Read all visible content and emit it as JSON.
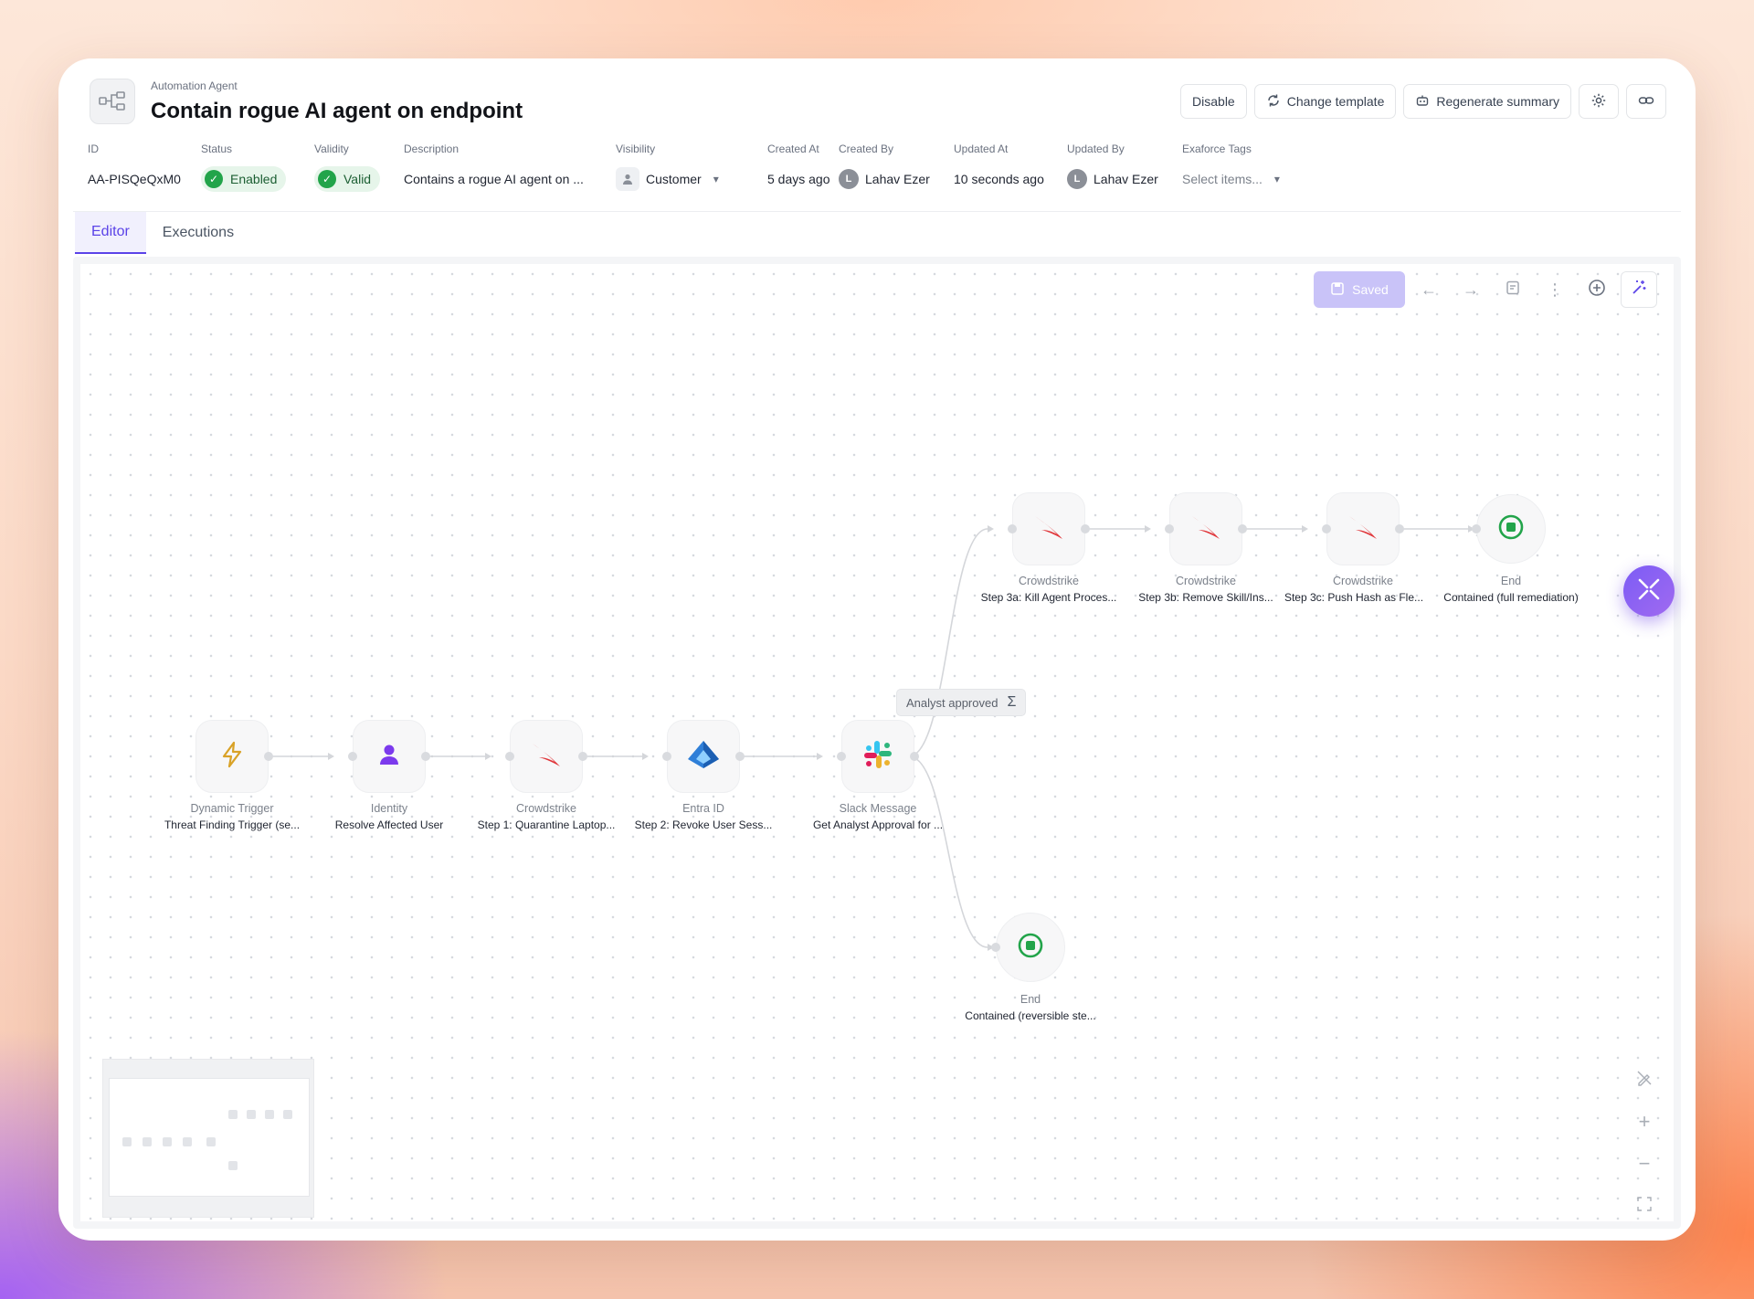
{
  "header": {
    "kicker": "Automation Agent",
    "title": "Contain rogue AI agent on endpoint",
    "actions": {
      "disable": "Disable",
      "change_template": "Change template",
      "regenerate_summary": "Regenerate summary"
    }
  },
  "meta": {
    "id": {
      "label": "ID",
      "value": "AA-PISQeQxM0"
    },
    "status": {
      "label": "Status",
      "value": "Enabled"
    },
    "validity": {
      "label": "Validity",
      "value": "Valid"
    },
    "description": {
      "label": "Description",
      "value": "Contains a rogue AI agent on ..."
    },
    "visibility": {
      "label": "Visibility",
      "value": "Customer"
    },
    "created_at": {
      "label": "Created At",
      "value": "5 days ago"
    },
    "created_by": {
      "label": "Created By",
      "value": "Lahav Ezer",
      "initial": "L"
    },
    "updated_at": {
      "label": "Updated At",
      "value": "10 seconds ago"
    },
    "updated_by": {
      "label": "Updated By",
      "value": "Lahav Ezer",
      "initial": "L"
    },
    "tags": {
      "label": "Exaforce Tags",
      "placeholder": "Select items..."
    }
  },
  "tabs": [
    {
      "label": "Editor",
      "active": true
    },
    {
      "label": "Executions",
      "active": false
    }
  ],
  "toolbar": {
    "saved_label": "Saved"
  },
  "workflow": {
    "edge_label": "Analyst approved",
    "nodes": [
      {
        "type": "Dynamic Trigger",
        "name": "Threat Finding Trigger (se...",
        "icon": "lightning-icon"
      },
      {
        "type": "Identity",
        "name": "Resolve Affected User",
        "icon": "user-icon"
      },
      {
        "type": "Crowdstrike",
        "name": "Step 1: Quarantine Laptop...",
        "icon": "crowdstrike-icon"
      },
      {
        "type": "Entra ID",
        "name": "Step 2: Revoke User Sess...",
        "icon": "entra-icon"
      },
      {
        "type": "Slack Message",
        "name": "Get Analyst Approval for ...",
        "icon": "slack-icon"
      },
      {
        "type": "Crowdstrike",
        "name": "Step 3a: Kill Agent Proces...",
        "icon": "crowdstrike-icon"
      },
      {
        "type": "Crowdstrike",
        "name": "Step 3b: Remove Skill/Ins...",
        "icon": "crowdstrike-icon"
      },
      {
        "type": "Crowdstrike",
        "name": "Step 3c: Push Hash as Fle...",
        "icon": "crowdstrike-icon"
      },
      {
        "type": "End",
        "name": "Contained (full remediation)",
        "icon": "stop-icon"
      },
      {
        "type": "End",
        "name": "Contained (reversible ste...",
        "icon": "stop-icon"
      }
    ]
  },
  "colors": {
    "accent": "#5b43e8",
    "success": "#22a44a",
    "crowdstrike": "#e0363a"
  }
}
